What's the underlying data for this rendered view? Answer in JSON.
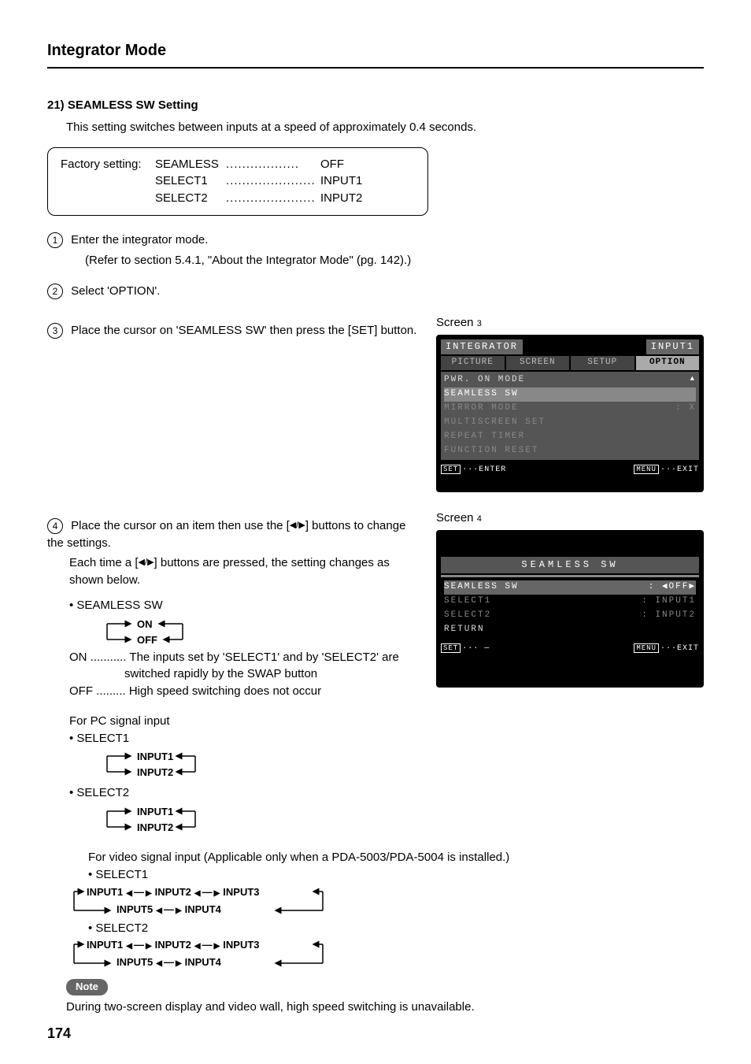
{
  "title": "Integrator Mode",
  "page_number": "174",
  "section": {
    "heading": "21) SEAMLESS SW Setting",
    "intro": "This setting switches between inputs at a speed of approximately 0.4 seconds."
  },
  "factory": {
    "label": "Factory setting:",
    "rows": [
      {
        "name": "SEAMLESS",
        "dots": "..................",
        "value": "OFF"
      },
      {
        "name": "SELECT1",
        "dots": "......................",
        "value": "INPUT1"
      },
      {
        "name": "SELECT2",
        "dots": "......................",
        "value": "INPUT2"
      }
    ]
  },
  "steps": {
    "s1": {
      "n": "1",
      "text": "Enter the integrator mode.",
      "sub": "(Refer to section 5.4.1, \"About the Integrator Mode\" (pg. 142).)"
    },
    "s2": {
      "n": "2",
      "text": "Select 'OPTION'."
    },
    "s3": {
      "n": "3",
      "text": "Place the cursor on 'SEAMLESS SW' then press the [SET] button."
    },
    "s4": {
      "n": "4",
      "text_a": "Place the cursor on an item then use the [",
      "text_b": "] buttons to change the settings.",
      "sub_a": "Each time a [",
      "sub_b": "] buttons are pressed, the setting changes as shown below."
    }
  },
  "seamless_sw": {
    "bullet": "• SEAMLESS SW",
    "on": "ON",
    "off": "OFF",
    "on_desc": "ON ........... The inputs set by 'SELECT1' and by 'SELECT2' are switched rapidly by the SWAP button",
    "off_desc": "OFF ......... High speed switching does not occur"
  },
  "pc_signal": {
    "heading": "For PC signal input",
    "select1": "• SELECT1",
    "select2": "• SELECT2",
    "i1": "INPUT1",
    "i2": "INPUT2"
  },
  "video_signal": {
    "heading": "For video signal input (Applicable only when a PDA-5003/PDA-5004 is installed.)",
    "select1": "• SELECT1",
    "select2": "• SELECT2",
    "i1": "INPUT1",
    "i2": "INPUT2",
    "i3": "INPUT3",
    "i4": "INPUT4",
    "i5": "INPUT5"
  },
  "note": {
    "label": "Note",
    "text": "During two-screen display and video wall, high speed switching is unavailable."
  },
  "screens": {
    "s3": {
      "label": "Screen ",
      "n": "3",
      "hdr_left": "INTEGRATOR",
      "hdr_right": "INPUT1",
      "tabs": [
        "PICTURE",
        "SCREEN",
        "SETUP",
        "OPTION"
      ],
      "active_tab": "OPTION",
      "rows": [
        {
          "l": "PWR. ON MODE",
          "r": ""
        },
        {
          "l": "SEAMLESS SW",
          "r": "",
          "sel": true
        },
        {
          "l": "MIRROR MODE",
          "r": ": X",
          "dim": true
        },
        {
          "l": "MULTISCREEN SET",
          "r": "",
          "dim": true
        },
        {
          "l": "REPEAT TIMER",
          "r": "",
          "dim": true
        },
        {
          "l": "FUNCTION RESET",
          "r": "",
          "dim": true
        }
      ],
      "footer_l": "ENTER",
      "footer_r": "EXIT",
      "tag_l": "SET",
      "tag_r": "MENU"
    },
    "s4": {
      "label": "Screen ",
      "n": "4",
      "title": "SEAMLESS SW",
      "rows": [
        {
          "l": "SEAMLESS SW",
          "r": ": ◀OFF▶",
          "sel": true
        },
        {
          "l": "  SELECT1",
          "r": ": INPUT1",
          "dim": true
        },
        {
          "l": "  SELECT2",
          "r": ": INPUT2",
          "dim": true
        },
        {
          "l": "  RETURN",
          "r": ""
        }
      ],
      "footer_l": "—",
      "footer_r": "EXIT",
      "tag_l": "SET",
      "tag_r": "MENU"
    }
  }
}
